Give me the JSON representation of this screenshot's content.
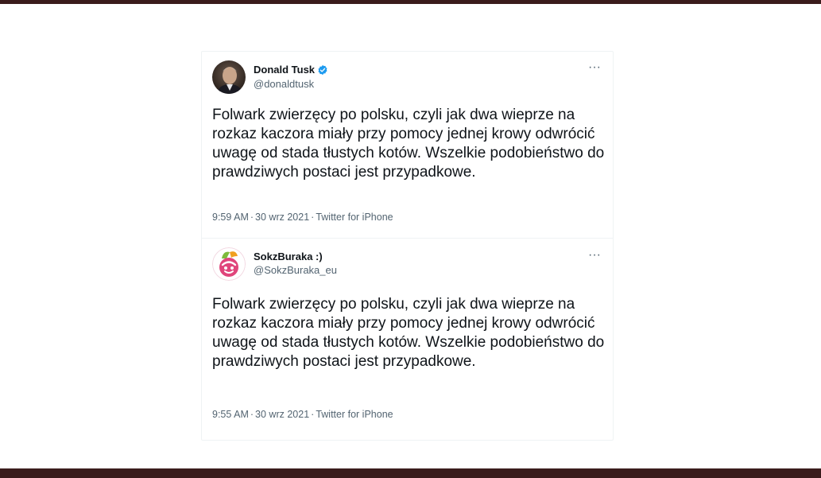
{
  "tweets": [
    {
      "display_name": "Donald Tusk",
      "handle": "@donaldtusk",
      "verified": true,
      "avatar_icon": "profile-photo",
      "more_icon": "three-dots-icon",
      "more_label": "···",
      "text": "Folwark zwierzęcy po polsku, czyli jak dwa wieprze na rozkaz kaczora miały przy pomocy jednej krowy odwrócić uwagę od stada tłustych kotów. Wszelkie podobieństwo do prawdziwych postaci jest przypadkowe.",
      "time": "9:59 AM",
      "separator": "·",
      "date": "30 wrz 2021",
      "source": "Twitter for iPhone"
    },
    {
      "display_name": "SokzBuraka :)",
      "handle": "@SokzBuraka_eu",
      "verified": false,
      "avatar_icon": "beet-juice-logo",
      "more_icon": "three-dots-icon",
      "more_label": "···",
      "text": "Folwark zwierzęcy po polsku, czyli jak dwa wieprze na rozkaz kaczora miały przy pomocy jednej krowy odwrócić uwagę od stada tłustych kotów. Wszelkie podobieństwo do prawdziwych postaci jest przypadkowe.",
      "time": "9:55 AM",
      "separator": "·",
      "date": "30 wrz 2021",
      "source": "Twitter for iPhone"
    }
  ],
  "colors": {
    "frame_bar": "#3a1c1c",
    "text_primary": "#0f1419",
    "text_secondary": "#536471",
    "verified_blue": "#1d9bf0",
    "card_border": "#eff3f4",
    "beet_pink": "#e0457b"
  }
}
